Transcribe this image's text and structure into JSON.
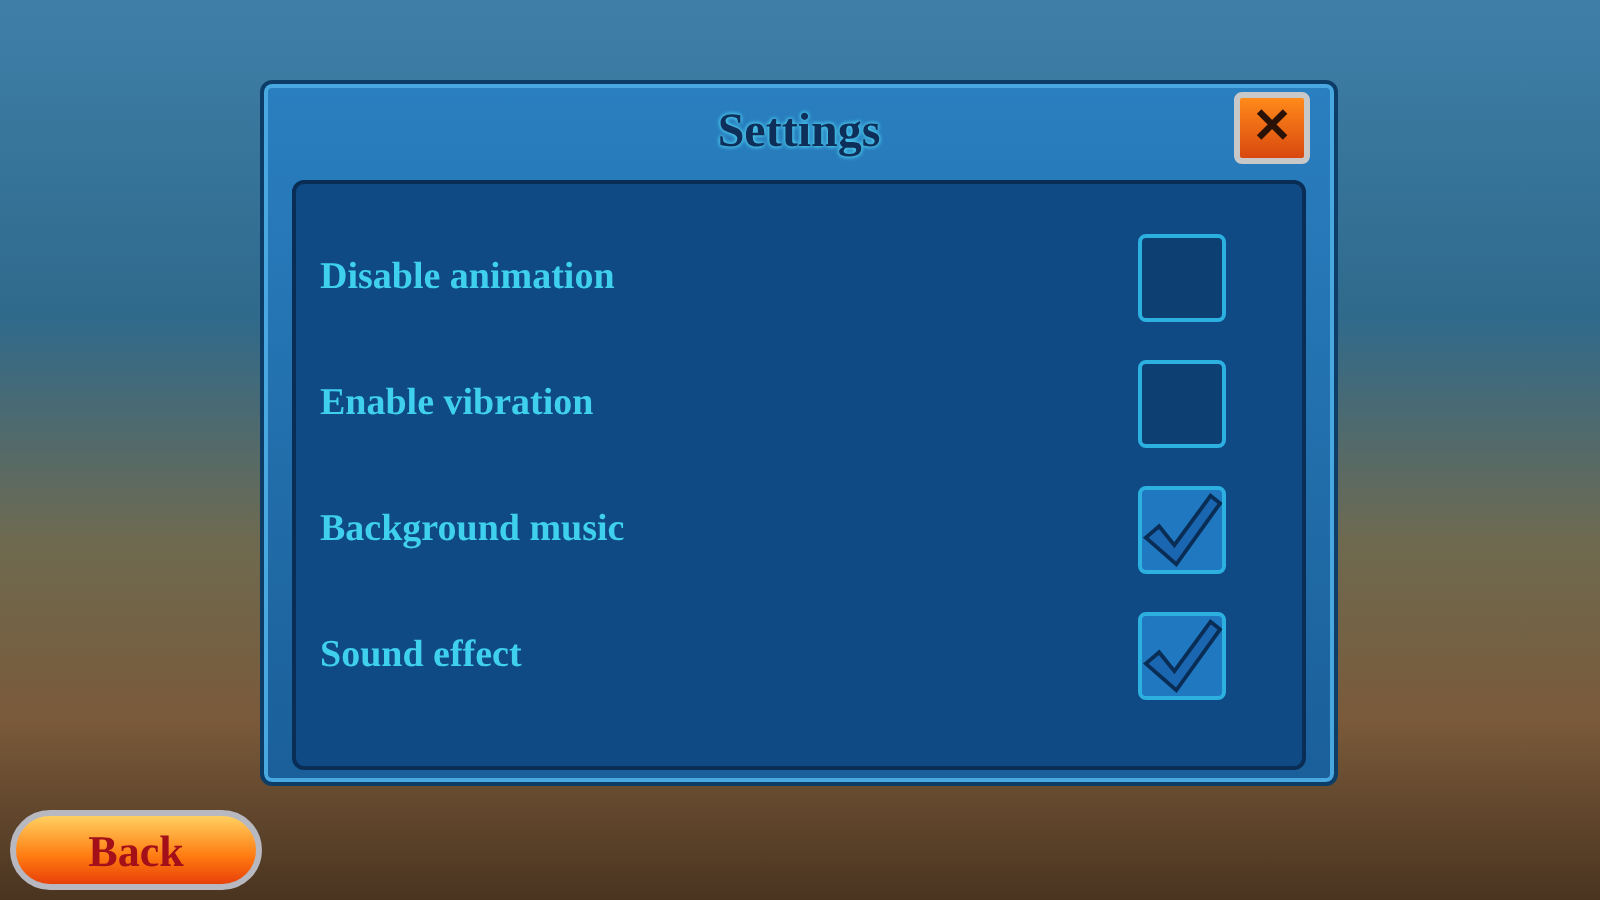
{
  "dialog": {
    "title": "Settings",
    "close": "✕"
  },
  "options": [
    {
      "label": "Disable animation",
      "checked": false
    },
    {
      "label": "Enable vibration",
      "checked": false
    },
    {
      "label": "Background music",
      "checked": true
    },
    {
      "label": "Sound effect",
      "checked": true
    }
  ],
  "back_button": {
    "label": "Back"
  }
}
